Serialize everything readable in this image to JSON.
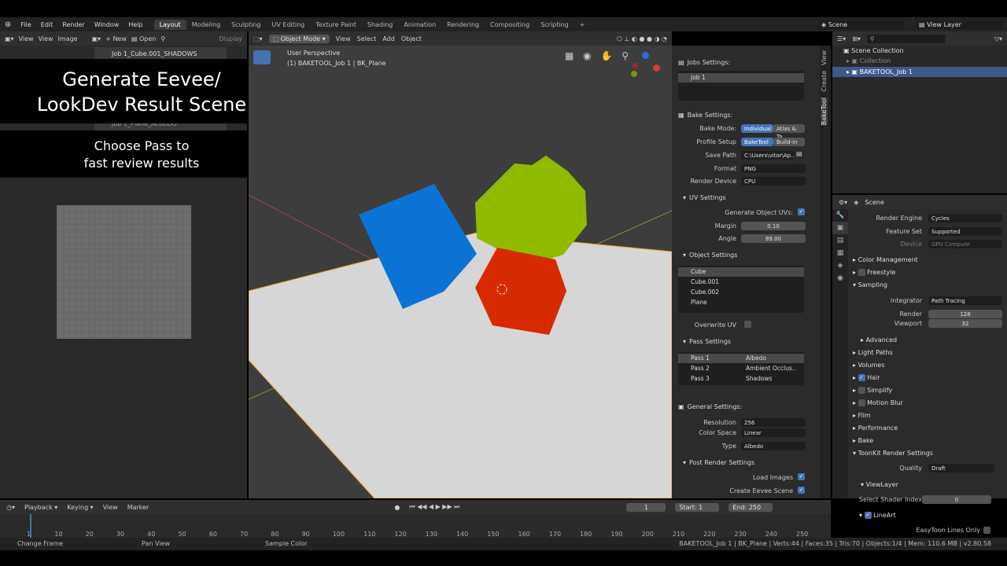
{
  "menu": [
    "File",
    "Edit",
    "Render",
    "Window",
    "Help"
  ],
  "workspaces": [
    "Layout",
    "Modeling",
    "Sculpting",
    "UV Editing",
    "Texture Paint",
    "Shading",
    "Animation",
    "Rendering",
    "Compositing",
    "Scripting"
  ],
  "workspace_add": "+",
  "scene_name": "Scene",
  "view_layer": "View Layer",
  "uv_editor": {
    "menus": [
      "View",
      "View",
      "Image"
    ],
    "new_label": "New",
    "open_label": "Open",
    "display_label": "Display",
    "image_list": [
      "Job 1_Cube.001_SHADOWS",
      "Job 1_Plane_ALBEDO"
    ]
  },
  "overlay": {
    "title_line1": "Generate Eevee/",
    "title_line2": "LookDev Result Scene",
    "sub_line1": "Choose Pass to",
    "sub_line2": "fast review results"
  },
  "viewport": {
    "mode": "Object Mode",
    "menus": [
      "View",
      "Select",
      "Add",
      "Object"
    ],
    "perspective": "User Perspective",
    "object_info": "(1) BAKETOOL_Job 1 | BK_Plane"
  },
  "bake_panel": {
    "tabs": [
      "View",
      "Create",
      "BakeTool"
    ],
    "jobs_settings": "Jobs Settings:",
    "job_item": "Job 1",
    "bake_settings": "Bake Settings:",
    "bake_mode_label": "Bake Mode:",
    "bake_mode_a": "Individual",
    "bake_mode_b": "Atlas & Ta..",
    "profile_label": "Profile Setup",
    "profile_a": "BakeTool",
    "profile_b": "Build-in",
    "save_path_label": "Save Path",
    "save_path": "C:\\Users\\vitor\\Ap..",
    "format_label": "Format",
    "format": "PNG",
    "render_device_label": "Render Device",
    "render_device": "CPU",
    "uv_settings": "UV Settings",
    "gen_uvs_label": "Generate Object UVs:",
    "margin_label": "Margin",
    "margin": "0.10",
    "angle_label": "Angle",
    "angle": "89.00",
    "object_settings": "Object Settings",
    "objects": [
      "Cube",
      "Cube.001",
      "Cube.002",
      "Plane"
    ],
    "overwrite_uv_label": "Overwrite UV",
    "pass_settings": "Pass Settings",
    "passes": [
      {
        "name": "Pass 1",
        "type": "Albedo"
      },
      {
        "name": "Pass 2",
        "type": "Ambient Occlus.."
      },
      {
        "name": "Pass 3",
        "type": "Shadows"
      }
    ],
    "general_settings": "General Settings:",
    "resolution_label": "Resolution",
    "resolution": "256",
    "color_space_label": "Color Space",
    "color_space": "Linear",
    "type_label": "Type",
    "type": "Albedo",
    "post_render": "Post Render Settings",
    "load_images_label": "Load Images",
    "create_eevee_label": "Create Eevee Scene"
  },
  "outliner": {
    "scene_collection": "Scene Collection",
    "collection": "Collection",
    "baketool_job": "BAKETOOL_Job 1"
  },
  "properties": {
    "title": "Scene",
    "render_engine_label": "Render Engine",
    "render_engine": "Cycles",
    "feature_set_label": "Feature Set",
    "feature_set": "Supported",
    "device_label": "Device",
    "device": "GPU Compute",
    "sections": [
      "Color Management",
      "Freestyle",
      "Sampling"
    ],
    "integrator_label": "Integrator",
    "integrator": "Path Tracing",
    "render_label": "Render",
    "render_samples": "128",
    "viewport_label": "Viewport",
    "viewport_samples": "32",
    "advanced": "Advanced",
    "light_paths": "Light Paths",
    "volumes": "Volumes",
    "hair": "Hair",
    "simplify": "Simplify",
    "motion_blur": "Motion Blur",
    "film": "Film",
    "performance": "Performance",
    "bake": "Bake",
    "toonkit": "ToonKit Render Settings",
    "quality_label": "Quality",
    "quality": "Draft",
    "viewlayer": "ViewLayer",
    "shader_index_label": "Select Shader Index",
    "shader_index": "0",
    "lineart": "LineArt",
    "easytoon_label": "EasyToon Lines Only"
  },
  "timeline": {
    "menus": [
      "Playback",
      "Keying",
      "View",
      "Marker"
    ],
    "current_frame": "1",
    "start_label": "Start:",
    "start": "1",
    "end_label": "End:",
    "end": "250",
    "ticks": [
      "1",
      "10",
      "20",
      "30",
      "40",
      "50",
      "60",
      "70",
      "80",
      "90",
      "100",
      "110",
      "120",
      "130",
      "140",
      "150",
      "160",
      "170",
      "180",
      "190",
      "200",
      "210",
      "220",
      "230",
      "240",
      "250"
    ]
  },
  "statusbar": {
    "change_frame": "Change Frame",
    "pan_view": "Pan View",
    "sample_color": "Sample Color",
    "stats": "BAKETOOL_Job 1 | BK_Plane | Verts:44 | Faces:35 | Tris:70 | Objects:1/4 | Mem: 110.6 MB | v2.80.58"
  },
  "colors": {
    "accent": "#4772b3",
    "cube_blue": "#0b73d4",
    "cube_green": "#8fba00",
    "cube_red": "#d82a00",
    "plane": "#d6d6d6"
  }
}
